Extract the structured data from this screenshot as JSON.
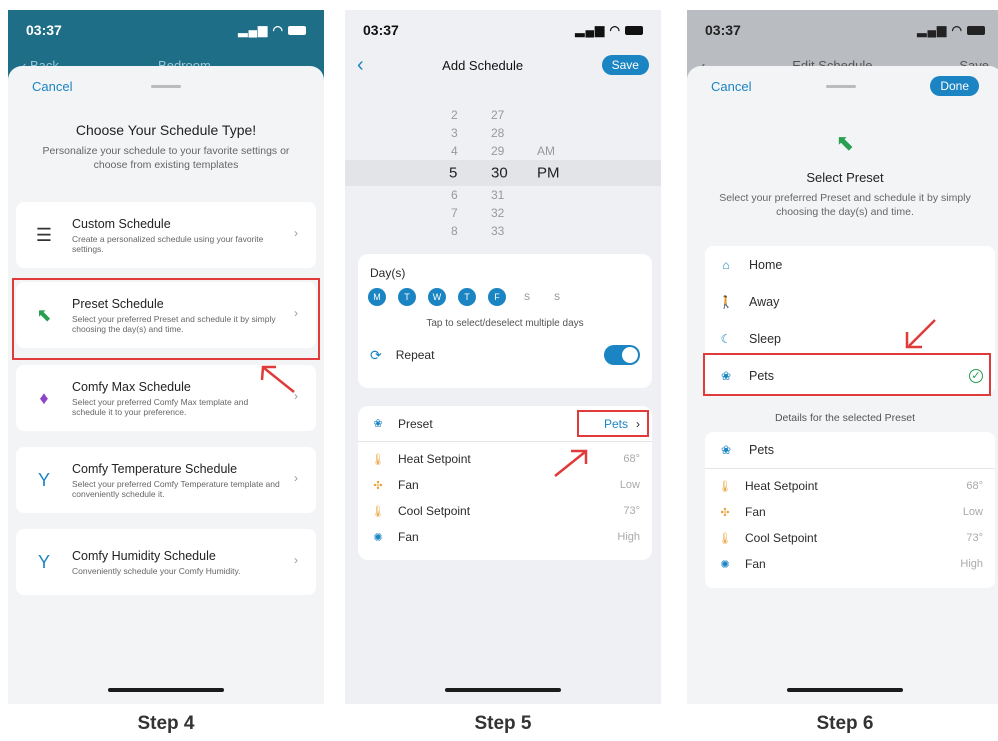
{
  "colors": {
    "accent": "#1b84c3",
    "highlight": "#e03a3a",
    "teal_header": "#1f6e87"
  },
  "step4": {
    "time": "03:37",
    "back_label": "Back",
    "room": "Bedroom",
    "cancel": "Cancel",
    "heading": "Choose Your Schedule Type!",
    "subheading": "Personalize your schedule to your favorite settings or choose from existing templates",
    "cards": [
      {
        "title": "Custom Schedule",
        "desc": "Create a personalized schedule using your favorite settings.",
        "icon": "sliders-icon"
      },
      {
        "title": "Preset Schedule",
        "desc": "Select your preferred Preset and schedule it by simply choosing the day(s) and time.",
        "icon": "preset-arrow-icon"
      },
      {
        "title": "Comfy Max Schedule",
        "desc": "Select your preferred Comfy Max template and schedule it to your preference.",
        "icon": "comfy-figure-icon"
      },
      {
        "title": "Comfy Temperature Schedule",
        "desc": "Select your preferred Comfy Temperature template and conveniently schedule it.",
        "icon": "comfy-figure-icon"
      },
      {
        "title": "Comfy Humidity Schedule",
        "desc": "Conveniently schedule your Comfy Humidity.",
        "icon": "comfy-figure-icon"
      }
    ],
    "caption": "Step 4"
  },
  "step5": {
    "time": "03:37",
    "title": "Add Schedule",
    "save": "Save",
    "picker_rows": [
      {
        "h": "2",
        "m": "27",
        "ampm": ""
      },
      {
        "h": "3",
        "m": "28",
        "ampm": ""
      },
      {
        "h": "4",
        "m": "29",
        "ampm": "AM"
      },
      {
        "h": "5",
        "m": "30",
        "ampm": "PM"
      },
      {
        "h": "6",
        "m": "31",
        "ampm": ""
      },
      {
        "h": "7",
        "m": "32",
        "ampm": ""
      },
      {
        "h": "8",
        "m": "33",
        "ampm": ""
      }
    ],
    "days_label": "Day(s)",
    "days": [
      {
        "l": "M",
        "on": true
      },
      {
        "l": "T",
        "on": true
      },
      {
        "l": "W",
        "on": true
      },
      {
        "l": "T",
        "on": true
      },
      {
        "l": "F",
        "on": true
      },
      {
        "l": "S",
        "on": false
      },
      {
        "l": "S",
        "on": false
      }
    ],
    "days_hint": "Tap to select/deselect multiple days",
    "repeat_label": "Repeat",
    "repeat_on": true,
    "preset_label": "Preset",
    "preset_value": "Pets",
    "settings": [
      {
        "label": "Heat Setpoint",
        "value": "68°",
        "icon": "thermometer-icon"
      },
      {
        "label": "Fan",
        "value": "Low",
        "icon": "fan-icon"
      },
      {
        "label": "Cool Setpoint",
        "value": "73°",
        "icon": "thermometer-icon"
      },
      {
        "label": "Fan",
        "value": "High",
        "icon": "fan-icon"
      }
    ],
    "caption": "Step 5"
  },
  "step6": {
    "time": "03:37",
    "behind_title": "Edit Schedule",
    "behind_save": "Save",
    "cancel": "Cancel",
    "done": "Done",
    "heading": "Select Preset",
    "subheading": "Select your preferred Preset and schedule it by simply choosing the day(s) and time.",
    "presets": [
      {
        "label": "Home",
        "icon": "home-icon"
      },
      {
        "label": "Away",
        "icon": "walking-icon"
      },
      {
        "label": "Sleep",
        "icon": "moon-icon"
      },
      {
        "label": "Pets",
        "icon": "paw-icon",
        "selected": true
      }
    ],
    "details_label": "Details for the selected Preset",
    "details_title": "Pets",
    "settings": [
      {
        "label": "Heat Setpoint",
        "value": "68°"
      },
      {
        "label": "Fan",
        "value": "Low"
      },
      {
        "label": "Cool Setpoint",
        "value": "73°"
      },
      {
        "label": "Fan",
        "value": "High"
      }
    ],
    "caption": "Step 6"
  }
}
